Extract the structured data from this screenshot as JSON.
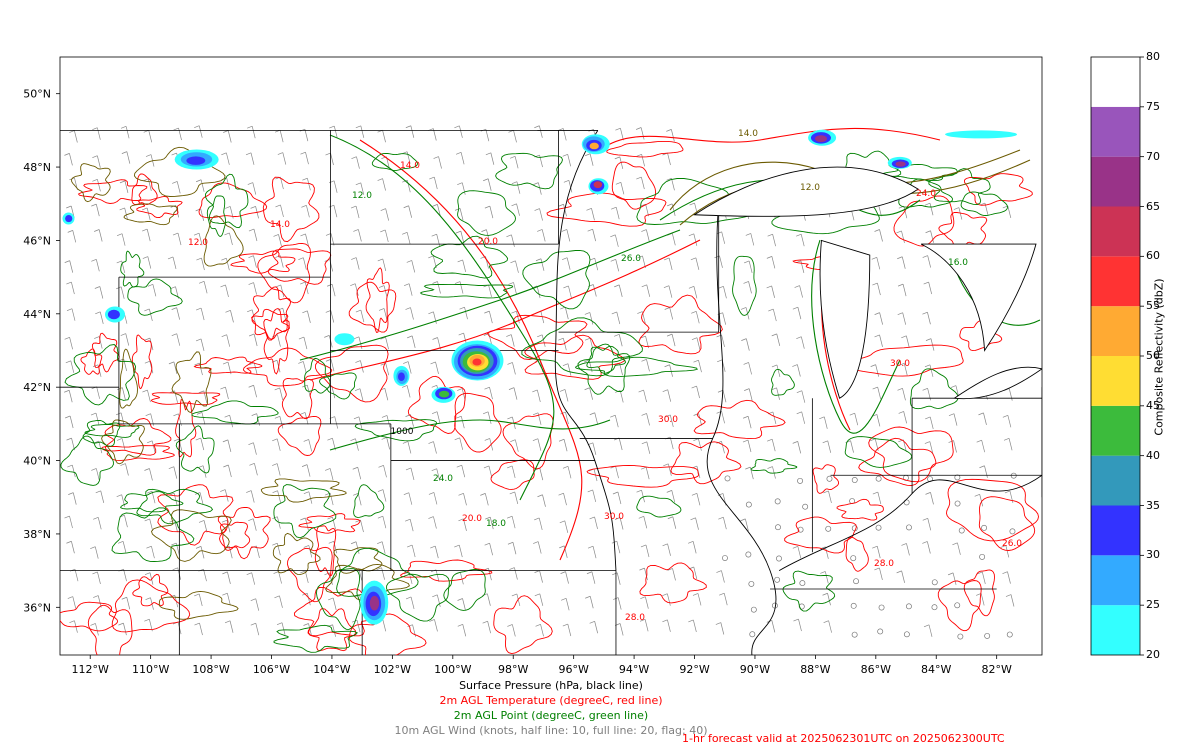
{
  "map": {
    "lon_ticks": [
      "112°W",
      "110°W",
      "108°W",
      "106°W",
      "104°W",
      "102°W",
      "100°W",
      "98°W",
      "96°W",
      "94°W",
      "92°W",
      "90°W",
      "88°W",
      "86°W",
      "84°W",
      "82°W"
    ],
    "lat_ticks": [
      "36°N",
      "38°N",
      "40°N",
      "42°N",
      "44°N",
      "46°N",
      "48°N",
      "50°N"
    ],
    "lon_range": [
      -113,
      -80.5
    ],
    "lat_range": [
      34.7,
      51.0
    ],
    "contour_labels": {
      "pressure": [
        "1000"
      ],
      "temperature": [
        "12.0",
        "14.0",
        "20.0",
        "24.0",
        "26.0",
        "28.0",
        "30.0"
      ],
      "dewpoint": [
        "12.0",
        "14.0",
        "16.0",
        "18.0",
        "20.0",
        "24.0",
        "26.0"
      ]
    },
    "colors": {
      "pressure": "#000000",
      "temperature": "#ff0000",
      "dewpoint": "#008000",
      "wind": "#808080"
    }
  },
  "captions": {
    "pressure": "Surface Pressure (hPa, black line)",
    "temperature": "2m AGL Temperature (degreeC, red line)",
    "dewpoint": "2m AGL Point (degreeC, green line)",
    "wind": "10m AGL Wind (knots, half line: 10, full line: 20, flag: 40)",
    "forecast": "1-hr forecast valid at 2025062301UTC on 2025062300UTC"
  },
  "colorbar": {
    "title": "Composite Reflectivity (dbZ)",
    "ticks": [
      "20",
      "25",
      "30",
      "35",
      "40",
      "45",
      "50",
      "55",
      "60",
      "65",
      "70",
      "75",
      "80"
    ],
    "colors": [
      "#33ffff",
      "#33aaff",
      "#3333ff",
      "#3399bb",
      "#3cbb3c",
      "#ffdd33",
      "#ffaa33",
      "#ff3333",
      "#cc3355",
      "#993388",
      "#9955bb",
      "#ffffff"
    ]
  }
}
